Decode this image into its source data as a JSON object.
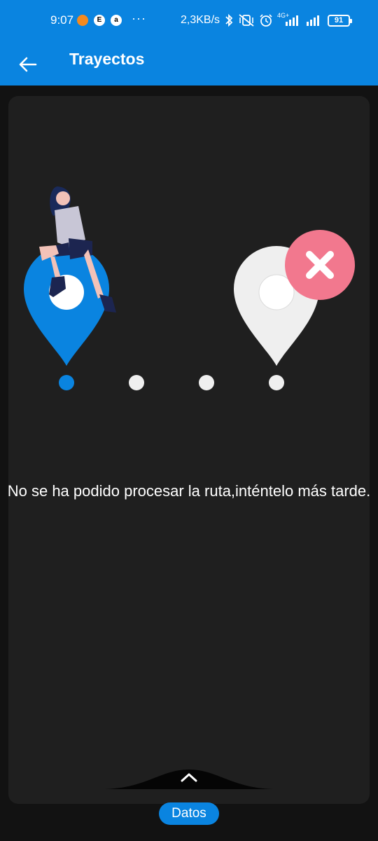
{
  "status_bar": {
    "time": "9:07",
    "app_icons": [
      {
        "name": "orange-app-icon",
        "glyph": "",
        "bg": "#F58A1F",
        "fg": "#fff"
      },
      {
        "name": "e-app-icon",
        "glyph": "E",
        "bg": "#FFFFFF",
        "fg": "#000"
      },
      {
        "name": "a-app-icon",
        "glyph": "a",
        "bg": "#FFFFFF",
        "fg": "#000"
      }
    ],
    "more": "···",
    "network_speed": "2,3KB/s",
    "network_type": "4G+",
    "battery": "91"
  },
  "app_bar": {
    "title": "Trayectos",
    "back_icon": "arrow-left-icon"
  },
  "content": {
    "message": "No se ha podido procesar la ruta,inténtelo más tarde.",
    "illustration": {
      "start_pin_color": "#0A84E0",
      "end_pin_color": "#EFEFEF",
      "error_badge_color": "#F2788E",
      "progress_dots": 4,
      "active_dot": 0
    }
  },
  "bottom": {
    "handle_icon": "chevron-up-icon",
    "datos_label": "Datos"
  },
  "colors": {
    "primary": "#0A84E0",
    "background": "#121212",
    "card": "#1F1F1F"
  }
}
